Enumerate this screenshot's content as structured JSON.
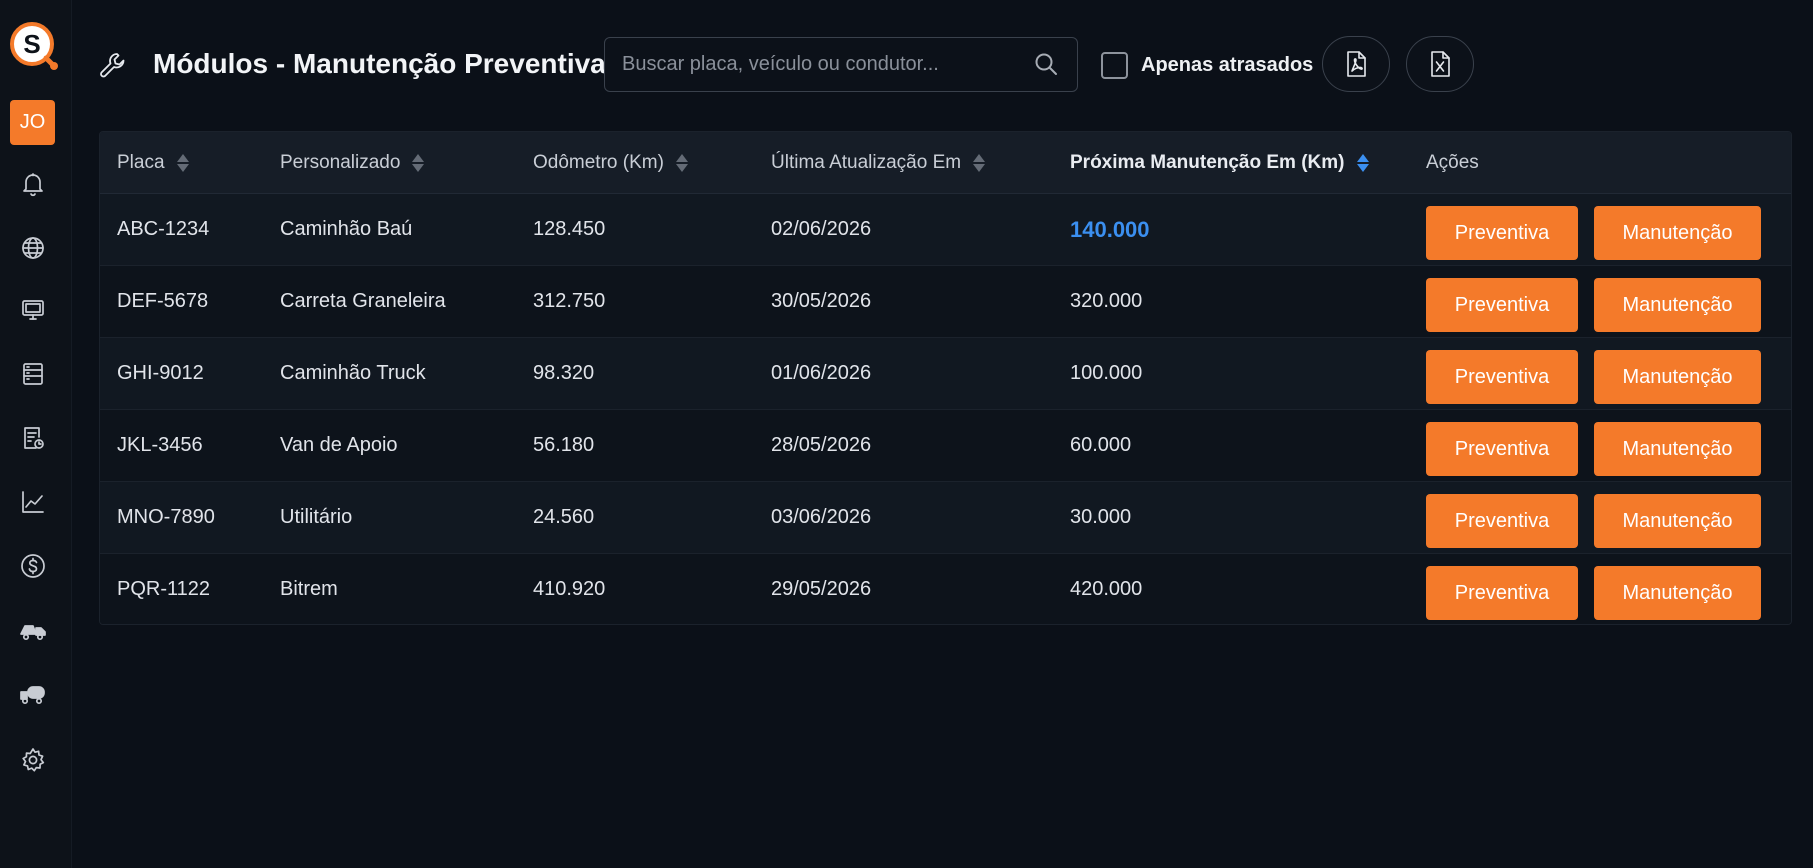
{
  "app": {
    "logo_letter": "S",
    "user_initials": "JO"
  },
  "sidebar": {
    "items": [
      {
        "icon": "bell-icon"
      },
      {
        "icon": "globe-icon"
      },
      {
        "icon": "monitor-icon"
      },
      {
        "icon": "server-icon"
      },
      {
        "icon": "report-icon"
      },
      {
        "icon": "chart-line-icon"
      },
      {
        "icon": "dollar-icon"
      },
      {
        "icon": "truck-icon"
      },
      {
        "icon": "tanker-truck-icon"
      },
      {
        "icon": "gear-icon"
      }
    ]
  },
  "header": {
    "title": "Módulos - Manutenção Preventiva",
    "search_placeholder": "Buscar placa, veículo ou condutor...",
    "search_value": "",
    "overdue_label": "Apenas atrasados",
    "overdue_checked": false,
    "export_pdf_icon": "pdf-file-icon",
    "export_excel_icon": "excel-file-icon"
  },
  "table": {
    "columns": {
      "placa": "Placa",
      "personalizado": "Personalizado",
      "odometro": "Odômetro (Km)",
      "ultima": "Última Atualização Em",
      "proxima": "Próxima Manutenção Em (Km)",
      "acoes": "Ações"
    },
    "sorted_column": "proxima",
    "rows": [
      {
        "placa": "ABC-1234",
        "personalizado": "Caminhão Baú",
        "odometro": "128.450",
        "ultima": "02/06/2026",
        "proxima": "140.000",
        "btn_preventiva": "Preventiva",
        "btn_manutencao": "Manutenção"
      },
      {
        "placa": "DEF-5678",
        "personalizado": "Carreta Graneleira",
        "odometro": "312.750",
        "ultima": "30/05/2026",
        "proxima": "320.000",
        "btn_preventiva": "Preventiva",
        "btn_manutencao": "Manutenção"
      },
      {
        "placa": "GHI-9012",
        "personalizado": "Caminhão Truck",
        "odometro": "98.320",
        "ultima": "01/06/2026",
        "proxima": "100.000",
        "btn_preventiva": "Preventiva",
        "btn_manutencao": "Manutenção"
      },
      {
        "placa": "JKL-3456",
        "personalizado": "Van de Apoio",
        "odometro": "56.180",
        "ultima": "28/05/2026",
        "proxima": "60.000",
        "btn_preventiva": "Preventiva",
        "btn_manutencao": "Manutenção"
      },
      {
        "placa": "MNO-7890",
        "personalizado": "Utilitário",
        "odometro": "24.560",
        "ultima": "03/06/2026",
        "proxima": "30.000",
        "btn_preventiva": "Preventiva",
        "btn_manutencao": "Manutenção"
      },
      {
        "placa": "PQR-1122",
        "personalizado": "Bitrem",
        "odometro": "410.920",
        "ultima": "29/05/2026",
        "proxima": "420.000",
        "btn_preventiva": "Preventiva",
        "btn_manutencao": "Manutenção"
      }
    ]
  },
  "colors": {
    "accent": "#f47a2a",
    "highlight": "#3b8ff0",
    "background": "#0b1018"
  }
}
